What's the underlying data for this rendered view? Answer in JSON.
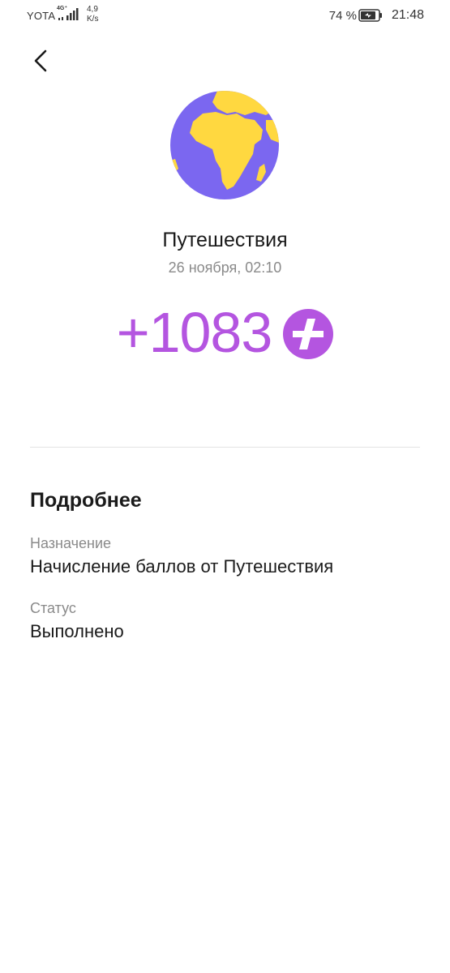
{
  "status_bar": {
    "carrier": "YOTA",
    "network_type": "4G⁺",
    "speed_value": "4,9",
    "speed_unit": "K/s",
    "battery_percent": "74 %",
    "time": "21:48"
  },
  "header": {
    "back_icon": "chevron-left-icon"
  },
  "transaction": {
    "icon": "globe-icon",
    "title": "Путешествия",
    "date": "26 ноября, 02:10",
    "amount": "+1083",
    "amount_icon": "plus-points-icon"
  },
  "details": {
    "section_title": "Подробнее",
    "purpose_label": "Назначение",
    "purpose_value": "Начисление баллов от Путешествия",
    "status_label": "Статус",
    "status_value": "Выполнено"
  },
  "colors": {
    "accent": "#b455e0",
    "globe_ocean": "#7b67f0",
    "globe_land": "#ffd840"
  }
}
